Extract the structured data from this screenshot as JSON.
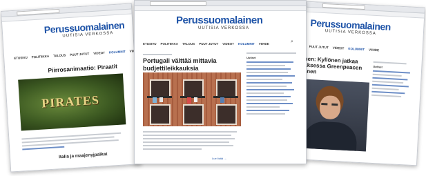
{
  "site": {
    "logo": "Perussuomalainen",
    "tagline": "UUTISIA VERKOSSA",
    "nav": [
      "ETUSIVU",
      "POLITIIKKA",
      "TALOUS",
      "PUUT JUTUT",
      "VIDEOT",
      "KOLUMNIT",
      "VIIHDE"
    ]
  },
  "left_page": {
    "headline": "Piirrosanimaatio: Piraatit",
    "image_text": "PIRATES",
    "subheadline": "Italia ja maajenyjpalkat"
  },
  "center_page": {
    "headline": "Portugali välttää mittavia budjettileikkauksia",
    "sidebar_title": "Uutiset",
    "caption": "Lue lisää →"
  },
  "right_page": {
    "headline_line1": "nen: Kyllönen jatkaa",
    "headline_line2": "aksessa Greenpeacen",
    "headline_line3": "enen",
    "sidebar_title": "Uutiset"
  },
  "colors": {
    "brand_blue": "#1f54a8",
    "pirate_green": "#2f4a18",
    "facade": "#b46a4a"
  }
}
